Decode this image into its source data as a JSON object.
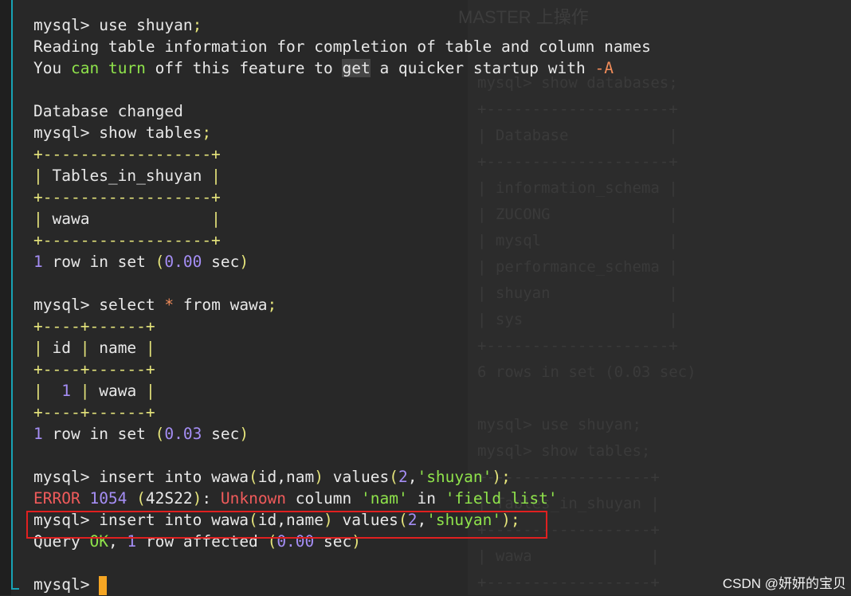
{
  "background": {
    "title": "MASTER 上操作",
    "lines": [
      "mysql> show databases;",
      "+--------------------+",
      "| Database           |",
      "+--------------------+",
      "| information_schema |",
      "| ZUCONG             |",
      "| mysql              |",
      "| performance_schema |",
      "| shuyan             |",
      "| sys                |",
      "+--------------------+",
      "6 rows in set (0.03 sec)",
      "",
      "mysql> use shuyan;",
      "mysql> show tables;",
      "+------------------+",
      "| Tables_in_shuyan |",
      "+------------------+",
      "| wawa             |",
      "+------------------+"
    ]
  },
  "terminal": {
    "prompt": "mysql>",
    "cmd_use": "use shuyan",
    "info_line1": "Reading table information for completion of table and column names",
    "info_line2_pre": "You ",
    "info_can": "can",
    "info_sp1": " ",
    "info_turn": "turn",
    "info_line2_mid": " off this feature to ",
    "info_get": "get",
    "info_line2_post": " a quicker startup with ",
    "info_flag": "-A",
    "db_changed": "Database changed",
    "cmd_show": "show tables",
    "tables_border": "+------------------+",
    "tables_header": " Tables_in_shuyan ",
    "tables_row": " wawa             ",
    "select_cmd_pre": "select ",
    "select_star": "*",
    "select_cmd_post": " from wawa",
    "sel_border": "+----+------+",
    "sel_header_id": " id ",
    "sel_header_name": " name ",
    "sel_row_id": "1",
    "sel_row_name": " wawa ",
    "result_rows": "1",
    "result_text": "row in set",
    "time1": "0.00",
    "time2": "0.03",
    "sec": "sec",
    "insert1_pre": "insert into wawa",
    "insert1_cols": "id,nam",
    "insert_values": "values",
    "insert_num": "2",
    "insert_str": "'shuyan'",
    "error_label": "ERROR",
    "error_code": "1054",
    "error_state": "42S22",
    "error_unknown": "Unknown",
    "error_column": "column",
    "error_nam": "'nam'",
    "error_in": "in",
    "error_field": "'field list'",
    "insert2_cols": "id,name",
    "query_label": "Query",
    "ok": "OK",
    "affected_num": "1",
    "affected_text": "row affected",
    "time3": "0.00"
  },
  "watermark": "CSDN @妍妍的宝贝",
  "colors": {
    "background": "#282828",
    "keyword_yellow": "#e5e47b",
    "green": "#8fe34b",
    "orange": "#f38d5a",
    "number_purple": "#a58ef5",
    "error_red": "#f05b5b",
    "cursor": "#f6a623",
    "highlight_box": "#e02020",
    "gutter_accent": "#18a3b5"
  }
}
